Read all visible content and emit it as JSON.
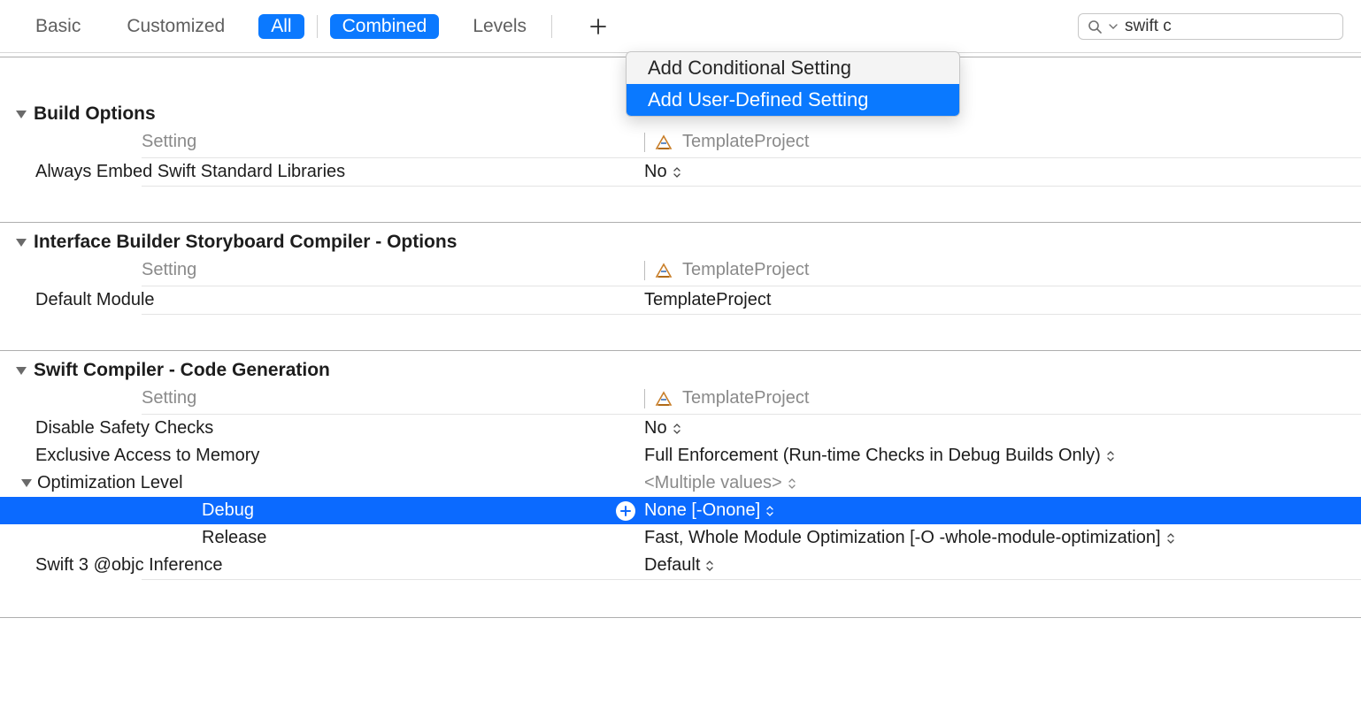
{
  "toolbar": {
    "basic": "Basic",
    "customized": "Customized",
    "all": "All",
    "combined": "Combined",
    "levels": "Levels",
    "search_value": "swift c"
  },
  "popover": {
    "conditional": "Add Conditional Setting",
    "user_defined": "Add User-Defined Setting"
  },
  "columns": {
    "setting": "Setting",
    "project": "TemplateProject"
  },
  "sections": {
    "build_options": {
      "title": "Build Options",
      "rows": [
        {
          "label": "Always Embed Swift Standard Libraries",
          "value": "No"
        }
      ]
    },
    "ib_compiler": {
      "title": "Interface Builder Storyboard Compiler - Options",
      "rows": [
        {
          "label": "Default Module",
          "value": "TemplateProject"
        }
      ]
    },
    "swift_codegen": {
      "title": "Swift Compiler - Code Generation",
      "rows": [
        {
          "label": "Disable Safety Checks",
          "value": "No"
        },
        {
          "label": "Exclusive Access to Memory",
          "value": "Full Enforcement (Run-time Checks in Debug Builds Only)"
        },
        {
          "label": "Optimization Level",
          "value": "<Multiple values>"
        },
        {
          "label": "Debug",
          "value": "None [-Onone]"
        },
        {
          "label": "Release",
          "value": "Fast, Whole Module Optimization  [-O -whole-module-optimization]"
        },
        {
          "label": "Swift 3 @objc Inference",
          "value": "Default"
        }
      ]
    }
  }
}
